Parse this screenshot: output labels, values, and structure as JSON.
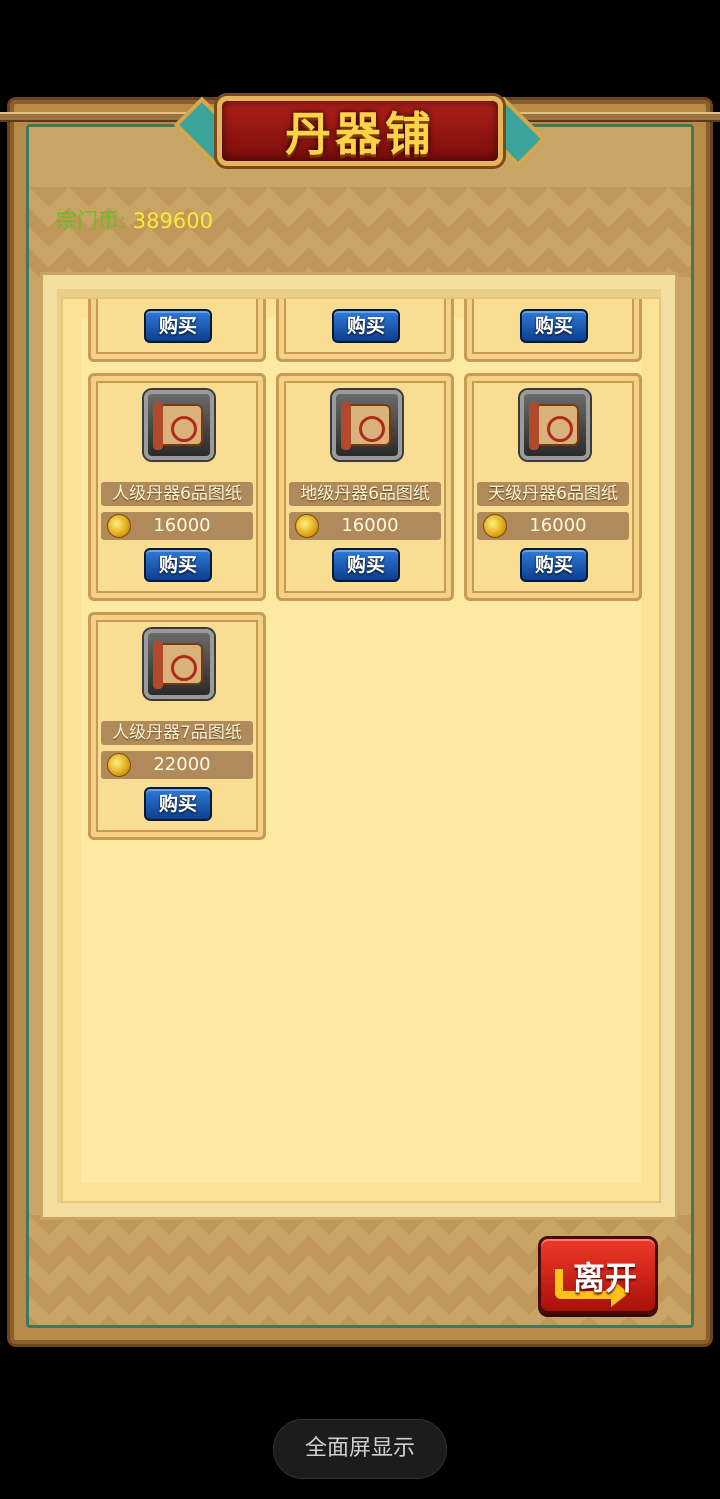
{
  "shop": {
    "title": "丹器铺",
    "currency_label": "宗门币:",
    "currency_value": "389600",
    "buy_label": "购买",
    "leave_label": "离开"
  },
  "items": [
    {
      "name": "",
      "price": "",
      "icon": "scroll-icon"
    },
    {
      "name": "",
      "price": "",
      "icon": "scroll-icon"
    },
    {
      "name": "",
      "price": "",
      "icon": "scroll-icon"
    },
    {
      "name": "人级丹器6品图纸",
      "price": "16000",
      "icon": "scroll-icon"
    },
    {
      "name": "地级丹器6品图纸",
      "price": "16000",
      "icon": "scroll-icon"
    },
    {
      "name": "天级丹器6品图纸",
      "price": "16000",
      "icon": "scroll-icon"
    },
    {
      "name": "人级丹器7品图纸",
      "price": "22000",
      "icon": "scroll-icon"
    }
  ],
  "system": {
    "fullscreen_label": "全面屏显示"
  },
  "colors": {
    "title_red": "#a01810",
    "title_gold": "#ffd24a",
    "currency_label": "#63c21f",
    "currency_value": "#ffe83a",
    "buy_blue": "#1a5cb8",
    "leave_red": "#d8201a"
  }
}
